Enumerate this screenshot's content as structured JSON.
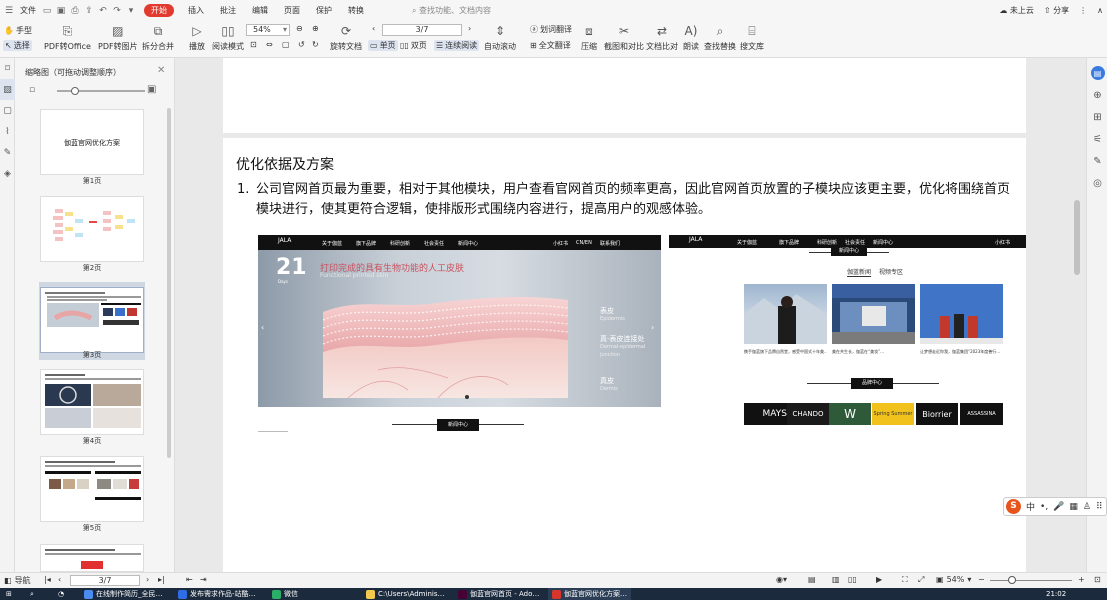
{
  "menubar": {
    "items": [
      "文件",
      "开始",
      "插入",
      "批注",
      "编辑",
      "页面",
      "保护",
      "转换"
    ],
    "search_placeholder": "查找功能、文档内容",
    "right": {
      "cloud": "未上云",
      "share": "分享"
    }
  },
  "ribbon": {
    "hand": "手型",
    "select": "选择",
    "pdf_to_office": "PDF转Office",
    "pdf_to_image": "PDF转图片",
    "split_merge": "拆分合并",
    "play": "播放",
    "read_mode": "阅读模式",
    "zoom": "54%",
    "rotate": "旋转文档",
    "single": "单页",
    "double": "双页",
    "continuous": "连续阅读",
    "page_indicator": "3/7",
    "autoscroll": "自动滚动",
    "translate_word": "划词翻译",
    "translate_all": "全文翻译",
    "compress": "压缩",
    "screenshot": "截图和对比",
    "compare": "文档比对",
    "read": "朗读",
    "find": "查找替换",
    "search_lib": "搜文库"
  },
  "thumbs": {
    "title": "缩略图（可拖动调整顺序）",
    "pages": [
      {
        "label": "第1页",
        "caption": "伽蓝官网优化方案"
      },
      {
        "label": "第2页",
        "caption": ""
      },
      {
        "label": "第3页",
        "caption": ""
      },
      {
        "label": "第4页",
        "caption": ""
      },
      {
        "label": "第5页",
        "caption": ""
      }
    ]
  },
  "doc": {
    "title": "优化依据及方案",
    "item_num": "1.",
    "item_text": "公司官网首页最为重要，相对于其他模块，用户查看官网首页的频率更高，因此官网首页放置的子模块应该更主要，优化将围绕首页模块进行，使其更符合逻辑，使排版形式围绕内容进行，提高用户的观感体验。",
    "shot1": {
      "logo": "JALA",
      "nav": [
        "关于伽蓝",
        "旗下品牌",
        "科研创新",
        "社会责任",
        "新闻中心"
      ],
      "nav_right": [
        "小红书",
        "CN/EN",
        "联系我们"
      ],
      "day": "21",
      "day_sub": "Days",
      "heading": "打印完成的具有生物功能的人工皮肤",
      "heading_en": "Functional printed skin",
      "labels": [
        {
          "cn": "表皮",
          "en": "Epidermis"
        },
        {
          "cn": "真-表皮连接处",
          "en": "Dermal-epidermal junction"
        },
        {
          "cn": "真皮",
          "en": "Dermis"
        }
      ],
      "news_center": "新闻中心"
    },
    "shot2": {
      "news_center": "新闻中心",
      "tabs": [
        "伽蓝新闻",
        "视频专区"
      ],
      "captions": [
        "携手伽蓝旗下品牌自然堂，感受中国式十年美…",
        "美在共生长，伽蓝在“美妆”…",
        "让梦想走近你我，伽蓝集团“2023年度善行…"
      ],
      "brand_center": "品牌中心",
      "brands": [
        {
          "name": "MAYSU",
          "bg": "#111111"
        },
        {
          "name": "CHANDO",
          "bg": "#1a1a1a"
        },
        {
          "name": "W",
          "bg": "#2f5a3a"
        },
        {
          "name": "Spring Summer",
          "bg": "#f1c21b"
        },
        {
          "name": "Biorrier",
          "bg": "#111111"
        },
        {
          "name": "ASSASSINA",
          "bg": "#111111"
        }
      ]
    }
  },
  "status": {
    "nav_label": "导航",
    "page": "3/7",
    "zoom": "54%"
  },
  "taskbar": {
    "items": [
      {
        "label": "在线制作简历_全民…",
        "color": "#4a8cf2"
      },
      {
        "label": "发布需求作品-站酷…",
        "color": "#2f6de6"
      },
      {
        "label": "微信",
        "color": "#2aae67"
      },
      {
        "label": "C:\\Users\\Adminis…",
        "color": "#f2c94c"
      },
      {
        "label": "伽蓝官网首页 - Ado…",
        "color": "#470137"
      },
      {
        "label": "伽蓝官网优化方案…",
        "color": "#d9362b"
      }
    ],
    "time": "21:02"
  },
  "ime": {
    "lang": "中"
  }
}
